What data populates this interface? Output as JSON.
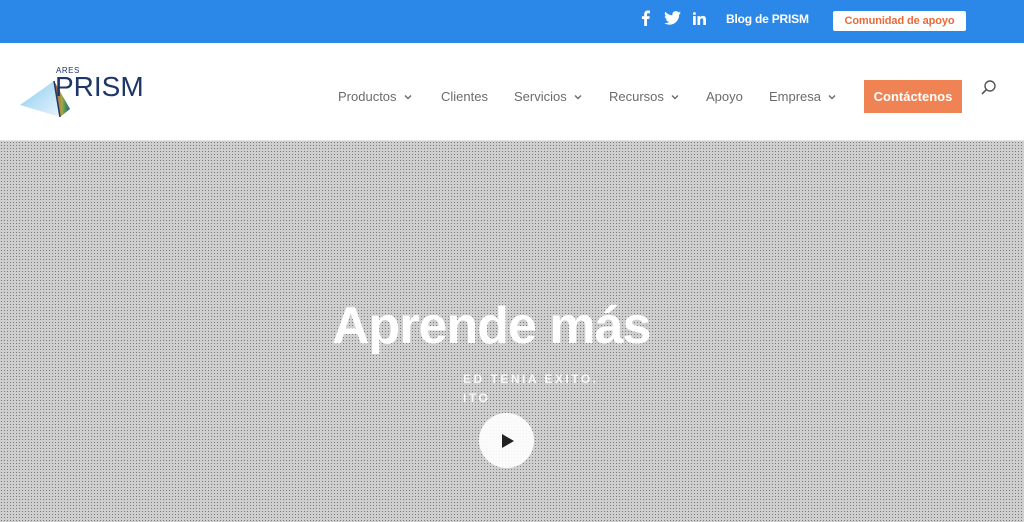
{
  "topbar": {
    "social": [
      {
        "icon": "facebook-icon"
      },
      {
        "icon": "twitter-icon"
      },
      {
        "icon": "linkedin-icon"
      }
    ],
    "blog_label": "Blog de PRISM",
    "support_label": "Comunidad de apoyo"
  },
  "header": {
    "logo": {
      "small_text": "ARES",
      "text": "PRISM"
    },
    "nav": [
      {
        "label": "Productos",
        "dropdown": true
      },
      {
        "label": "Clientes",
        "dropdown": false
      },
      {
        "label": "Servicios",
        "dropdown": true
      },
      {
        "label": "Recursos",
        "dropdown": true
      },
      {
        "label": "Apoyo",
        "dropdown": false
      },
      {
        "label": "Empresa",
        "dropdown": true
      }
    ],
    "contact_label": "Contáctenos",
    "search_icon": "search-icon"
  },
  "hero": {
    "title": "Aprende más",
    "subtitle_line1": "ED TENIA EXITO.",
    "subtitle_line2": "ITO",
    "play_icon": "play-icon"
  },
  "colors": {
    "topbar": "#2b88e8",
    "accent": "#f08354",
    "brand": "#1f3768"
  }
}
